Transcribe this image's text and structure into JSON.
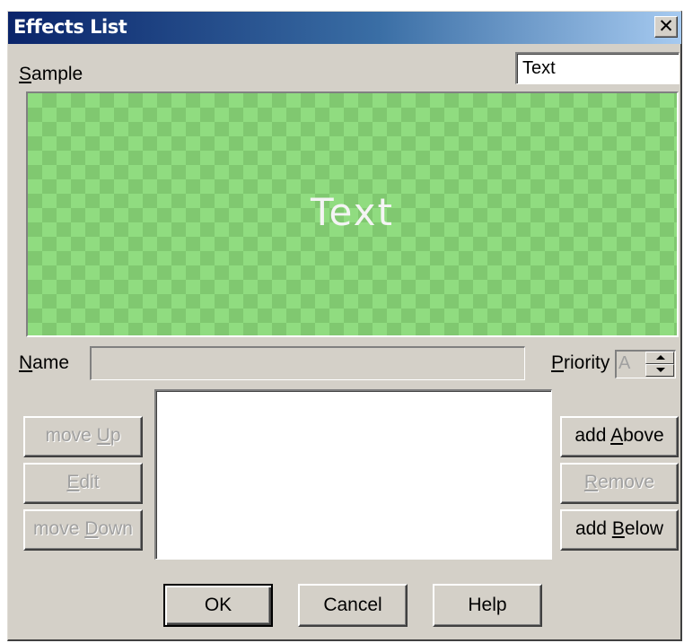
{
  "window": {
    "title": "Effects List",
    "close_glyph": "✕",
    "close_icon": "close-icon"
  },
  "sample": {
    "label_accel": "S",
    "label_rest": "ample",
    "input_value": "Text",
    "preview_text": "Text",
    "preview_colors": {
      "light": "#90dc80",
      "dark": "#80c870"
    }
  },
  "name_field": {
    "label_accel": "N",
    "label_rest": "ame",
    "value": ""
  },
  "priority": {
    "label_accel": "P",
    "label_rest": "riority",
    "value": "A",
    "spin_icons": [
      "spin-up-icon",
      "spin-down-icon"
    ]
  },
  "effects_list": {
    "items": []
  },
  "left_buttons": {
    "move_up": {
      "pre": "move ",
      "accel": "U",
      "post": "p",
      "enabled": false
    },
    "edit": {
      "pre": "",
      "accel": "E",
      "post": "dit",
      "enabled": false
    },
    "move_down": {
      "pre": "move ",
      "accel": "D",
      "post": "own",
      "enabled": false
    }
  },
  "right_buttons": {
    "add_above": {
      "pre": "add ",
      "accel": "A",
      "post": "bove",
      "enabled": true
    },
    "remove": {
      "pre": "",
      "accel": "R",
      "post": "emove",
      "enabled": false
    },
    "add_below": {
      "pre": "add ",
      "accel": "B",
      "post": "elow",
      "enabled": true
    }
  },
  "footer": {
    "ok": "OK",
    "cancel": "Cancel",
    "help": "Help"
  }
}
